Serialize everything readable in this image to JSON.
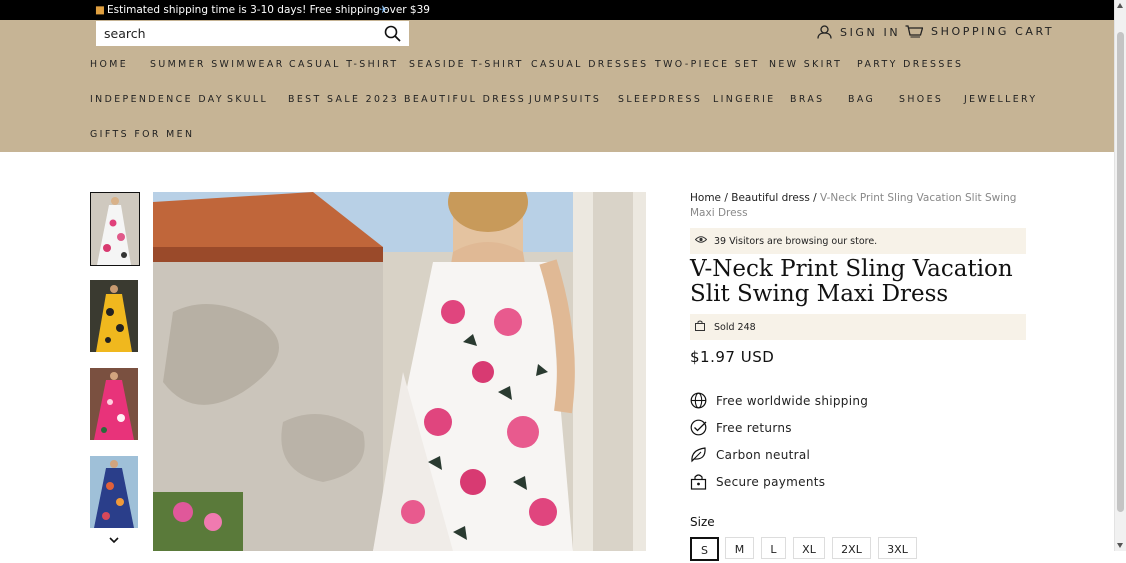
{
  "announcement": {
    "text": "Estimated shipping time is 3-10 days! Free shipping over $39"
  },
  "header": {
    "search_placeholder": "search",
    "sign_in": "SIGN IN",
    "cart": "SHOPPING CART"
  },
  "nav": {
    "row1": [
      "HOME",
      "SUMMER SWIMWEAR",
      "CASUAL T-SHIRT",
      "SEASIDE T-SHIRT",
      "CASUAL DRESSES",
      "TWO-PIECE SET",
      "NEW SKIRT",
      "PARTY DRESSES"
    ],
    "row2": [
      "INDEPENDENCE DAY",
      "SKULL",
      "BEST SALE 2023",
      "BEAUTIFUL DRESS",
      "JUMPSUITS",
      "SLEEPDRESS",
      "LINGERIE",
      "BRAS",
      "BAG",
      "SHOES",
      "JEWELLERY"
    ],
    "row3": [
      "GIFTS FOR MEN"
    ]
  },
  "breadcrumb": {
    "home": "Home",
    "sep": "/",
    "category": "Beautiful dress",
    "current": "V-Neck Print Sling Vacation Slit Swing Maxi Dress"
  },
  "product": {
    "visitors": "39 Visitors are browsing our store.",
    "title": "V-Neck Print Sling Vacation Slit Swing Maxi Dress",
    "sold": "Sold 248",
    "price": "$1.97 USD"
  },
  "features": [
    "Free worldwide shipping",
    "Free returns",
    "Carbon neutral",
    "Secure payments"
  ],
  "size": {
    "label": "Size",
    "options": [
      "S",
      "M",
      "L",
      "XL",
      "2XL",
      "3XL"
    ],
    "selected": "S"
  },
  "colors": {
    "header_bg": "#c6b495",
    "announce_bg": "#000000",
    "notice_bg": "#f7f2e8"
  }
}
